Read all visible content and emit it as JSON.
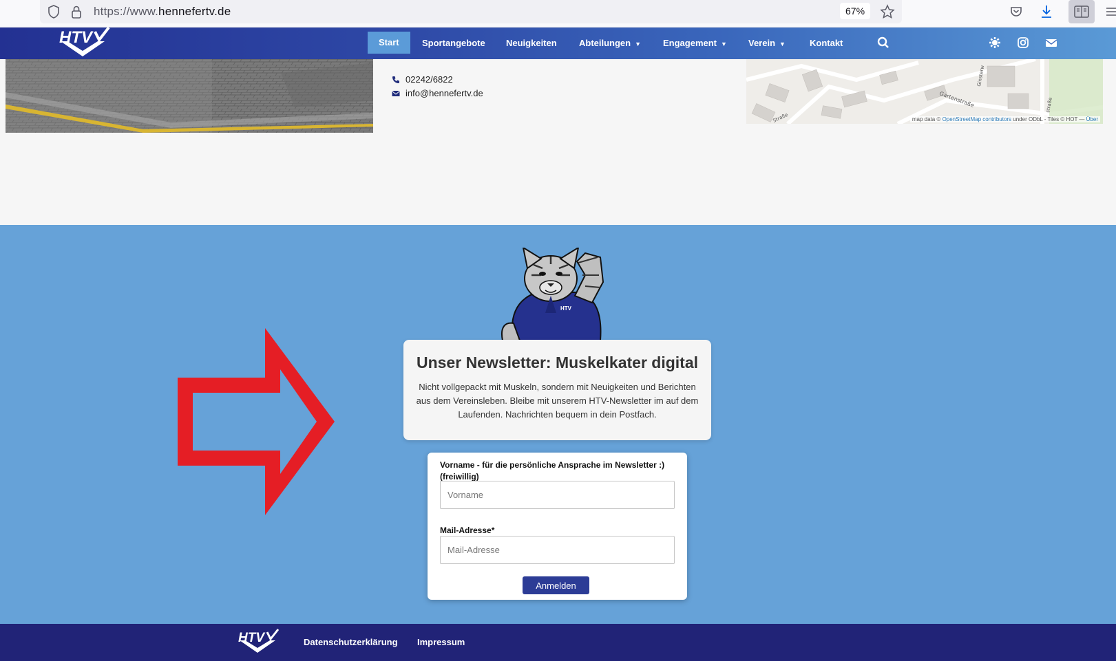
{
  "browser": {
    "url_prefix": "https://www.",
    "url_domain": "hennefertv.de",
    "zoom": "67%"
  },
  "nav": {
    "items": [
      {
        "label": "Start",
        "active": true
      },
      {
        "label": "Sportangebote"
      },
      {
        "label": "Neuigkeiten"
      },
      {
        "label": "Abteilungen",
        "dropdown": true
      },
      {
        "label": "Engagement",
        "dropdown": true
      },
      {
        "label": "Verein",
        "dropdown": true
      },
      {
        "label": "Kontakt"
      }
    ],
    "icons": [
      "search-icon",
      "settings-icon",
      "instagram-icon",
      "mail-icon"
    ]
  },
  "contact": {
    "phone": "02242/6822",
    "email": "info@hennefertv.de"
  },
  "map": {
    "labels": [
      "Gartenstraße",
      "Ginsterw",
      "straße",
      "Straße"
    ],
    "attribution_prefix": "map data © ",
    "attribution_link": "OpenStreetMap contributors",
    "attribution_mid": " under ODbL - Tiles © HOT — ",
    "attribution_link2": "Über"
  },
  "newsletter": {
    "title": "Unser Newsletter: Muskelkater digital",
    "description": "Nicht vollgepackt mit Muskeln, sondern mit Neuigkeiten und Berichten aus dem Vereinsleben. Bleibe mit unserem HTV-Newsletter im auf dem Laufenden. Nachrichten bequem in dein Postfach.",
    "mascot_shirt_text": "HTV"
  },
  "form": {
    "firstname_label_line1": "Vorname - für die persönliche Ansprache im Newsletter :)",
    "firstname_label_line2": "(freiwillig)",
    "firstname_placeholder": "Vorname",
    "email_label": "Mail-Adresse*",
    "email_placeholder": "Mail-Adresse",
    "submit_label": "Anmelden"
  },
  "footer": {
    "links": [
      "Datenschutzerklärung",
      "Impressum"
    ]
  },
  "brand": {
    "logo_text": "HTV"
  },
  "colors": {
    "nav_start": "#233192",
    "nav_end": "#5a9ad6",
    "section_bg": "#66a2d8",
    "footer_bg": "#212377",
    "arrow_red": "#e51e25",
    "button_bg": "#2c3c96"
  }
}
